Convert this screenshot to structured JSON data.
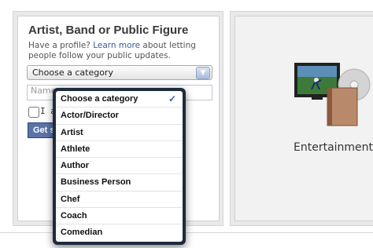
{
  "left_card": {
    "title": "Artist, Band or Public Figure",
    "desc_before": "Have a profile? ",
    "desc_link": "Learn more",
    "desc_after": " about letting people follow your public updates.",
    "select_value": "Choose a category",
    "name_placeholder": "Name",
    "agree_label": "I a",
    "get_button": "Get s"
  },
  "dropdown": {
    "options": [
      {
        "label": "Choose a category",
        "selected": true
      },
      {
        "label": "Actor/Director"
      },
      {
        "label": "Artist"
      },
      {
        "label": "Athlete"
      },
      {
        "label": "Author"
      },
      {
        "label": "Business Person"
      },
      {
        "label": "Chef"
      },
      {
        "label": "Coach"
      },
      {
        "label": "Comedian"
      }
    ],
    "check_glyph": "✓"
  },
  "right_card": {
    "label": "Entertainment"
  },
  "colors": {
    "link": "#3b5998",
    "button": "#5b74a8",
    "dropdown_frame": "#1e2a3e",
    "check": "#2f5fb3"
  },
  "icons": [
    "chevron-down-icon",
    "checkmark-icon",
    "tv-icon",
    "disc-icon",
    "book-icon"
  ]
}
